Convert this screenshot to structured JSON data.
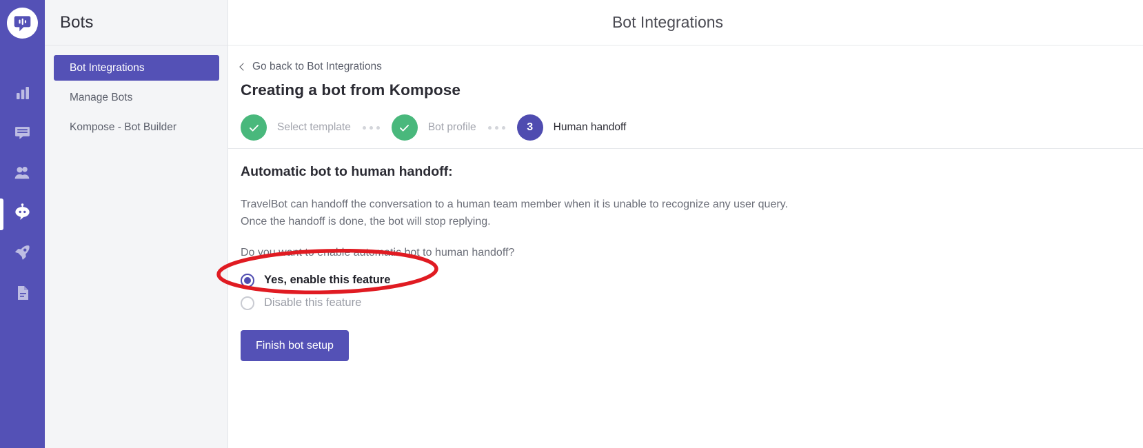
{
  "rail": {
    "logo_name": "kommunicate-logo",
    "brand_color": "#5451b6",
    "items": [
      {
        "name": "analytics-icon",
        "label": "Analytics",
        "active": false
      },
      {
        "name": "conversations-icon",
        "label": "Conversations",
        "active": false
      },
      {
        "name": "users-icon",
        "label": "Users",
        "active": false
      },
      {
        "name": "bots-icon",
        "label": "Bots",
        "active": true
      },
      {
        "name": "integrations-icon",
        "label": "Integrations",
        "active": false
      },
      {
        "name": "docs-icon",
        "label": "Docs",
        "active": false
      }
    ]
  },
  "sidebar": {
    "title": "Bots",
    "items": [
      {
        "label": "Bot Integrations",
        "active": true
      },
      {
        "label": "Manage Bots",
        "active": false
      },
      {
        "label": "Kompose - Bot Builder",
        "active": false
      }
    ]
  },
  "header": {
    "title": "Bot Integrations"
  },
  "main": {
    "go_back_label": "Go back to Bot Integrations",
    "page_title": "Creating a bot from Kompose",
    "steps": [
      {
        "indicator": "✓",
        "label": "Select template",
        "state": "done"
      },
      {
        "indicator": "✓",
        "label": "Bot profile",
        "state": "done"
      },
      {
        "indicator": "3",
        "label": "Human handoff",
        "state": "current"
      }
    ],
    "section_title": "Automatic bot to human handoff:",
    "paragraph_line1": "TravelBot can handoff the conversation to a human team member when it is unable to recognize any user query.",
    "paragraph_line2": "Once the handoff is done, the bot will stop replying.",
    "question": "Do you want to enable automatic bot to human handoff?",
    "options": [
      {
        "label": "Yes, enable this feature",
        "checked": true
      },
      {
        "label": "Disable this feature",
        "checked": false
      }
    ],
    "finish_label": "Finish bot setup"
  },
  "annotation": {
    "shape": "ellipse",
    "color": "#e01b22",
    "target": "Yes, enable this feature"
  },
  "colors": {
    "brand_purple": "#5451b6",
    "step_done_green": "#49b87c",
    "step_current_purple": "#4f4cb0",
    "sidebar_bg": "#f4f5f7",
    "annotation_red": "#e01b22"
  }
}
